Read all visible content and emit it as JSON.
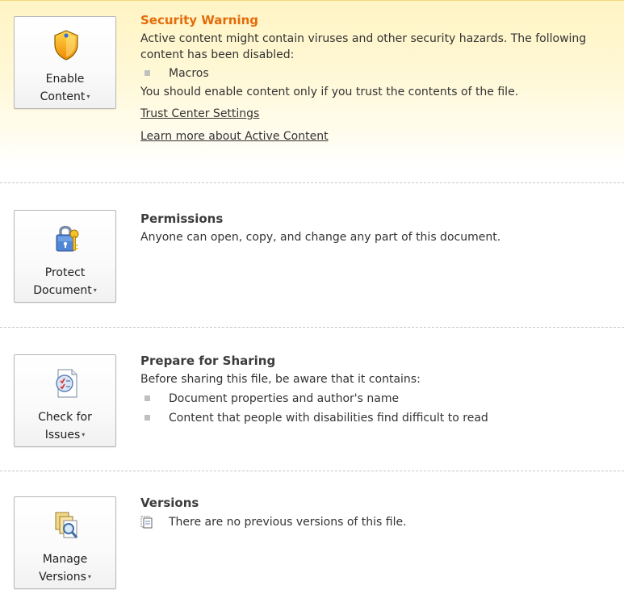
{
  "security": {
    "button_line1": "Enable",
    "button_line2": "Content",
    "title": "Security Warning",
    "description": "Active content might contain viruses and other security hazards. The following content has been disabled:",
    "items": [
      "Macros"
    ],
    "advice": "You should enable content only if you trust the contents of the file.",
    "link_trust_center": "Trust Center Settings",
    "link_learn_more": "Learn more about Active Content",
    "accent_color": "#e36c0a",
    "icon": "shield-icon"
  },
  "permissions": {
    "button_line1": "Protect",
    "button_line2": "Document",
    "title": "Permissions",
    "description": "Anyone can open, copy, and change any part of this document.",
    "icon": "lock-key-icon"
  },
  "sharing": {
    "button_line1": "Check for",
    "button_line2": "Issues",
    "title": "Prepare for Sharing",
    "description": "Before sharing this file, be aware that it contains:",
    "items": [
      "Document properties and author's name",
      "Content that people with disabilities find difficult to read"
    ],
    "icon": "checklist-icon"
  },
  "versions": {
    "button_line1": "Manage",
    "button_line2": "Versions",
    "title": "Versions",
    "description": "There are no previous versions of this file.",
    "icon": "versions-magnifier-icon"
  },
  "dropdown_arrow": "▾"
}
